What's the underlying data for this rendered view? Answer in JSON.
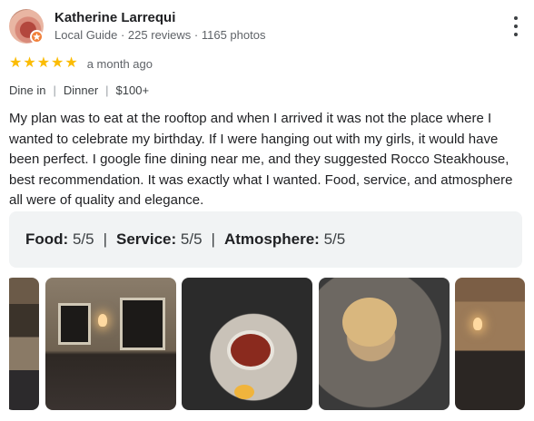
{
  "review": {
    "author_name": "Katherine Larrequi",
    "author_meta": "Local Guide · 225 reviews · 1165 photos",
    "rating": 5,
    "stars": [
      "★",
      "★",
      "★",
      "★",
      "★"
    ],
    "date": "a month ago",
    "tags": [
      "Dine in",
      "Dinner",
      "$100+"
    ],
    "tag_separator": "|",
    "text": "My plan was to eat at the rooftop and when I arrived it was not the place where I wanted to celebrate my birthday. If I were hanging out with my girls, it would have been perfect. I google fine dining near me, and they suggested Rocco Steakhouse, best recommendation. It was exactly what I wanted. Food, service, and atmosphere all were of quality and elegance.",
    "attributes": [
      {
        "label": "Food:",
        "value": "5/5"
      },
      {
        "label": "Service:",
        "value": "5/5"
      },
      {
        "label": "Atmosphere:",
        "value": "5/5"
      }
    ],
    "attribute_separator": "|"
  },
  "icons": {
    "avatar": "avatar-photo",
    "guide_badge": "local-guide-star-icon",
    "more": "more-vert-icon",
    "star": "star-icon"
  },
  "colors": {
    "star": "#fbbc04",
    "badge": "#f1813b",
    "attr_bg": "#f1f3f4",
    "meta_text": "#5f6368"
  }
}
